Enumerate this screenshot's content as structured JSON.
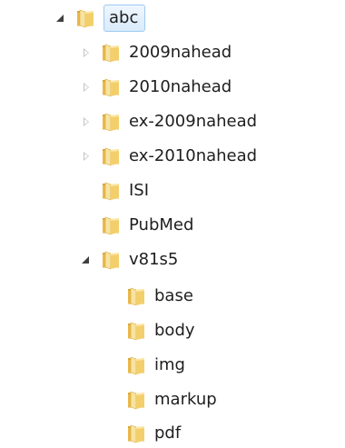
{
  "tree": {
    "root": {
      "label": "abc",
      "icon": "folder-icon",
      "state": "expanded",
      "selected": true
    },
    "children": [
      {
        "label": "2009nahead",
        "icon": "folder-icon",
        "state": "collapsed"
      },
      {
        "label": "2010nahead",
        "icon": "folder-icon",
        "state": "collapsed"
      },
      {
        "label": "ex-2009nahead",
        "icon": "folder-icon",
        "state": "collapsed"
      },
      {
        "label": "ex-2010nahead",
        "icon": "folder-icon",
        "state": "collapsed"
      },
      {
        "label": "ISI",
        "icon": "folder-icon",
        "state": "none"
      },
      {
        "label": "PubMed",
        "icon": "folder-icon",
        "state": "none"
      },
      {
        "label": "v81s5",
        "icon": "folder-icon",
        "state": "expanded"
      }
    ],
    "v81s5_children": [
      {
        "label": "base",
        "icon": "folder-icon",
        "state": "none"
      },
      {
        "label": "body",
        "icon": "folder-icon",
        "state": "none"
      },
      {
        "label": "img",
        "icon": "folder-icon",
        "state": "none"
      },
      {
        "label": "markup",
        "icon": "folder-icon",
        "state": "none"
      },
      {
        "label": "pdf",
        "icon": "folder-icon",
        "state": "none"
      }
    ]
  },
  "colors": {
    "selection_border": "#9fcbf0",
    "selection_fill": "#d9ebfb",
    "text": "#1e1e1e",
    "folder_body": "#e8c45a",
    "folder_front": "#f6dc86",
    "folder_dark": "#c9962e"
  }
}
